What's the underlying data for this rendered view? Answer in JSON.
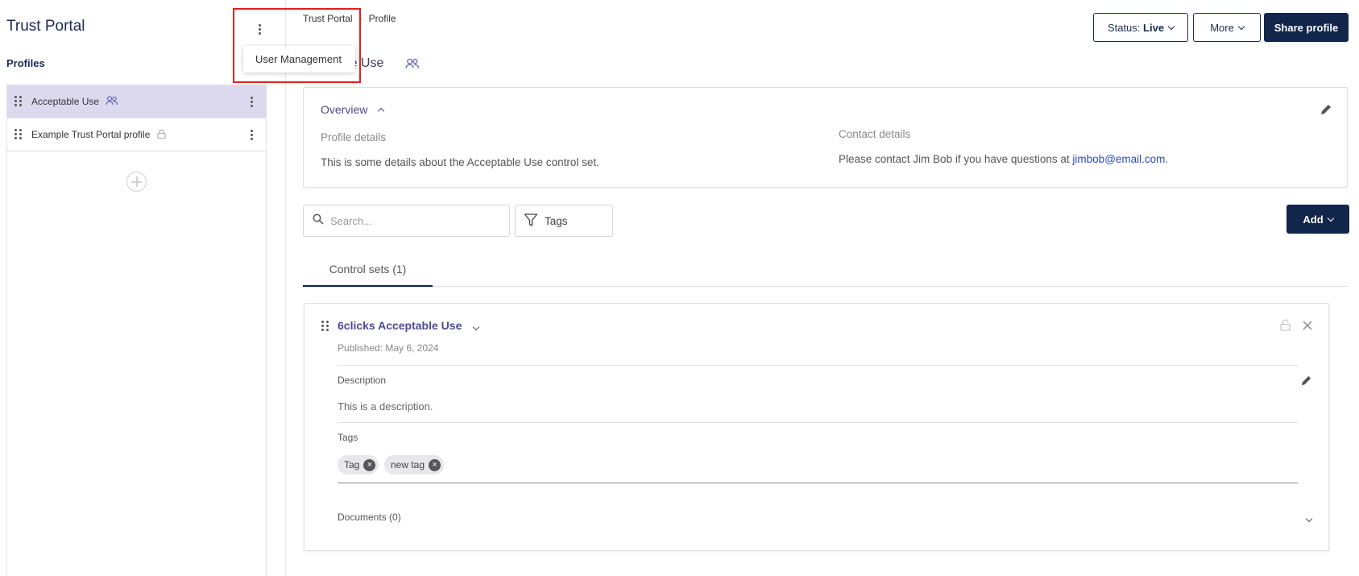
{
  "sidebar": {
    "title": "Trust Portal",
    "menu": {
      "items": [
        "User Management"
      ]
    },
    "profiles_heading": "Profiles",
    "profiles": [
      {
        "label": "Acceptable Use",
        "icon": "group-icon",
        "active": true
      },
      {
        "label": "Example Trust Portal profile",
        "icon": "lock-icon",
        "active": false
      }
    ]
  },
  "breadcrumb": [
    "Trust Portal",
    "Profile"
  ],
  "page": {
    "title": "Acceptable Use",
    "title_visible_fragment": "le Use"
  },
  "header_actions": {
    "status_prefix": "Status:",
    "status_value": "Live",
    "more_label": "More",
    "share_label": "Share profile"
  },
  "overview": {
    "toggle_label": "Overview",
    "profile_details_label": "Profile details",
    "profile_details_text": "This is some details about the Acceptable Use control set.",
    "contact_label": "Contact details",
    "contact_text": "Please contact Jim Bob if you have questions at ",
    "contact_email": "jimbob@email.com",
    "contact_suffix": "."
  },
  "search": {
    "placeholder": "Search..."
  },
  "tags_filter": {
    "label": "Tags"
  },
  "add_button": {
    "label": "Add"
  },
  "tabs": [
    {
      "label": "Control sets (1)",
      "active": true
    }
  ],
  "control_set": {
    "title": "6clicks Acceptable Use",
    "published": "Published: May 6, 2024",
    "description_label": "Description",
    "description_text": "This is a description.",
    "tags_label": "Tags",
    "tags": [
      "Tag",
      "new tag"
    ],
    "documents_label": "Documents (0)"
  },
  "colors": {
    "primary": "#12254a",
    "accent": "#4a4a99",
    "active_row": "#dcd9ef",
    "highlight": "#e0201f",
    "link": "#2b49c9"
  }
}
